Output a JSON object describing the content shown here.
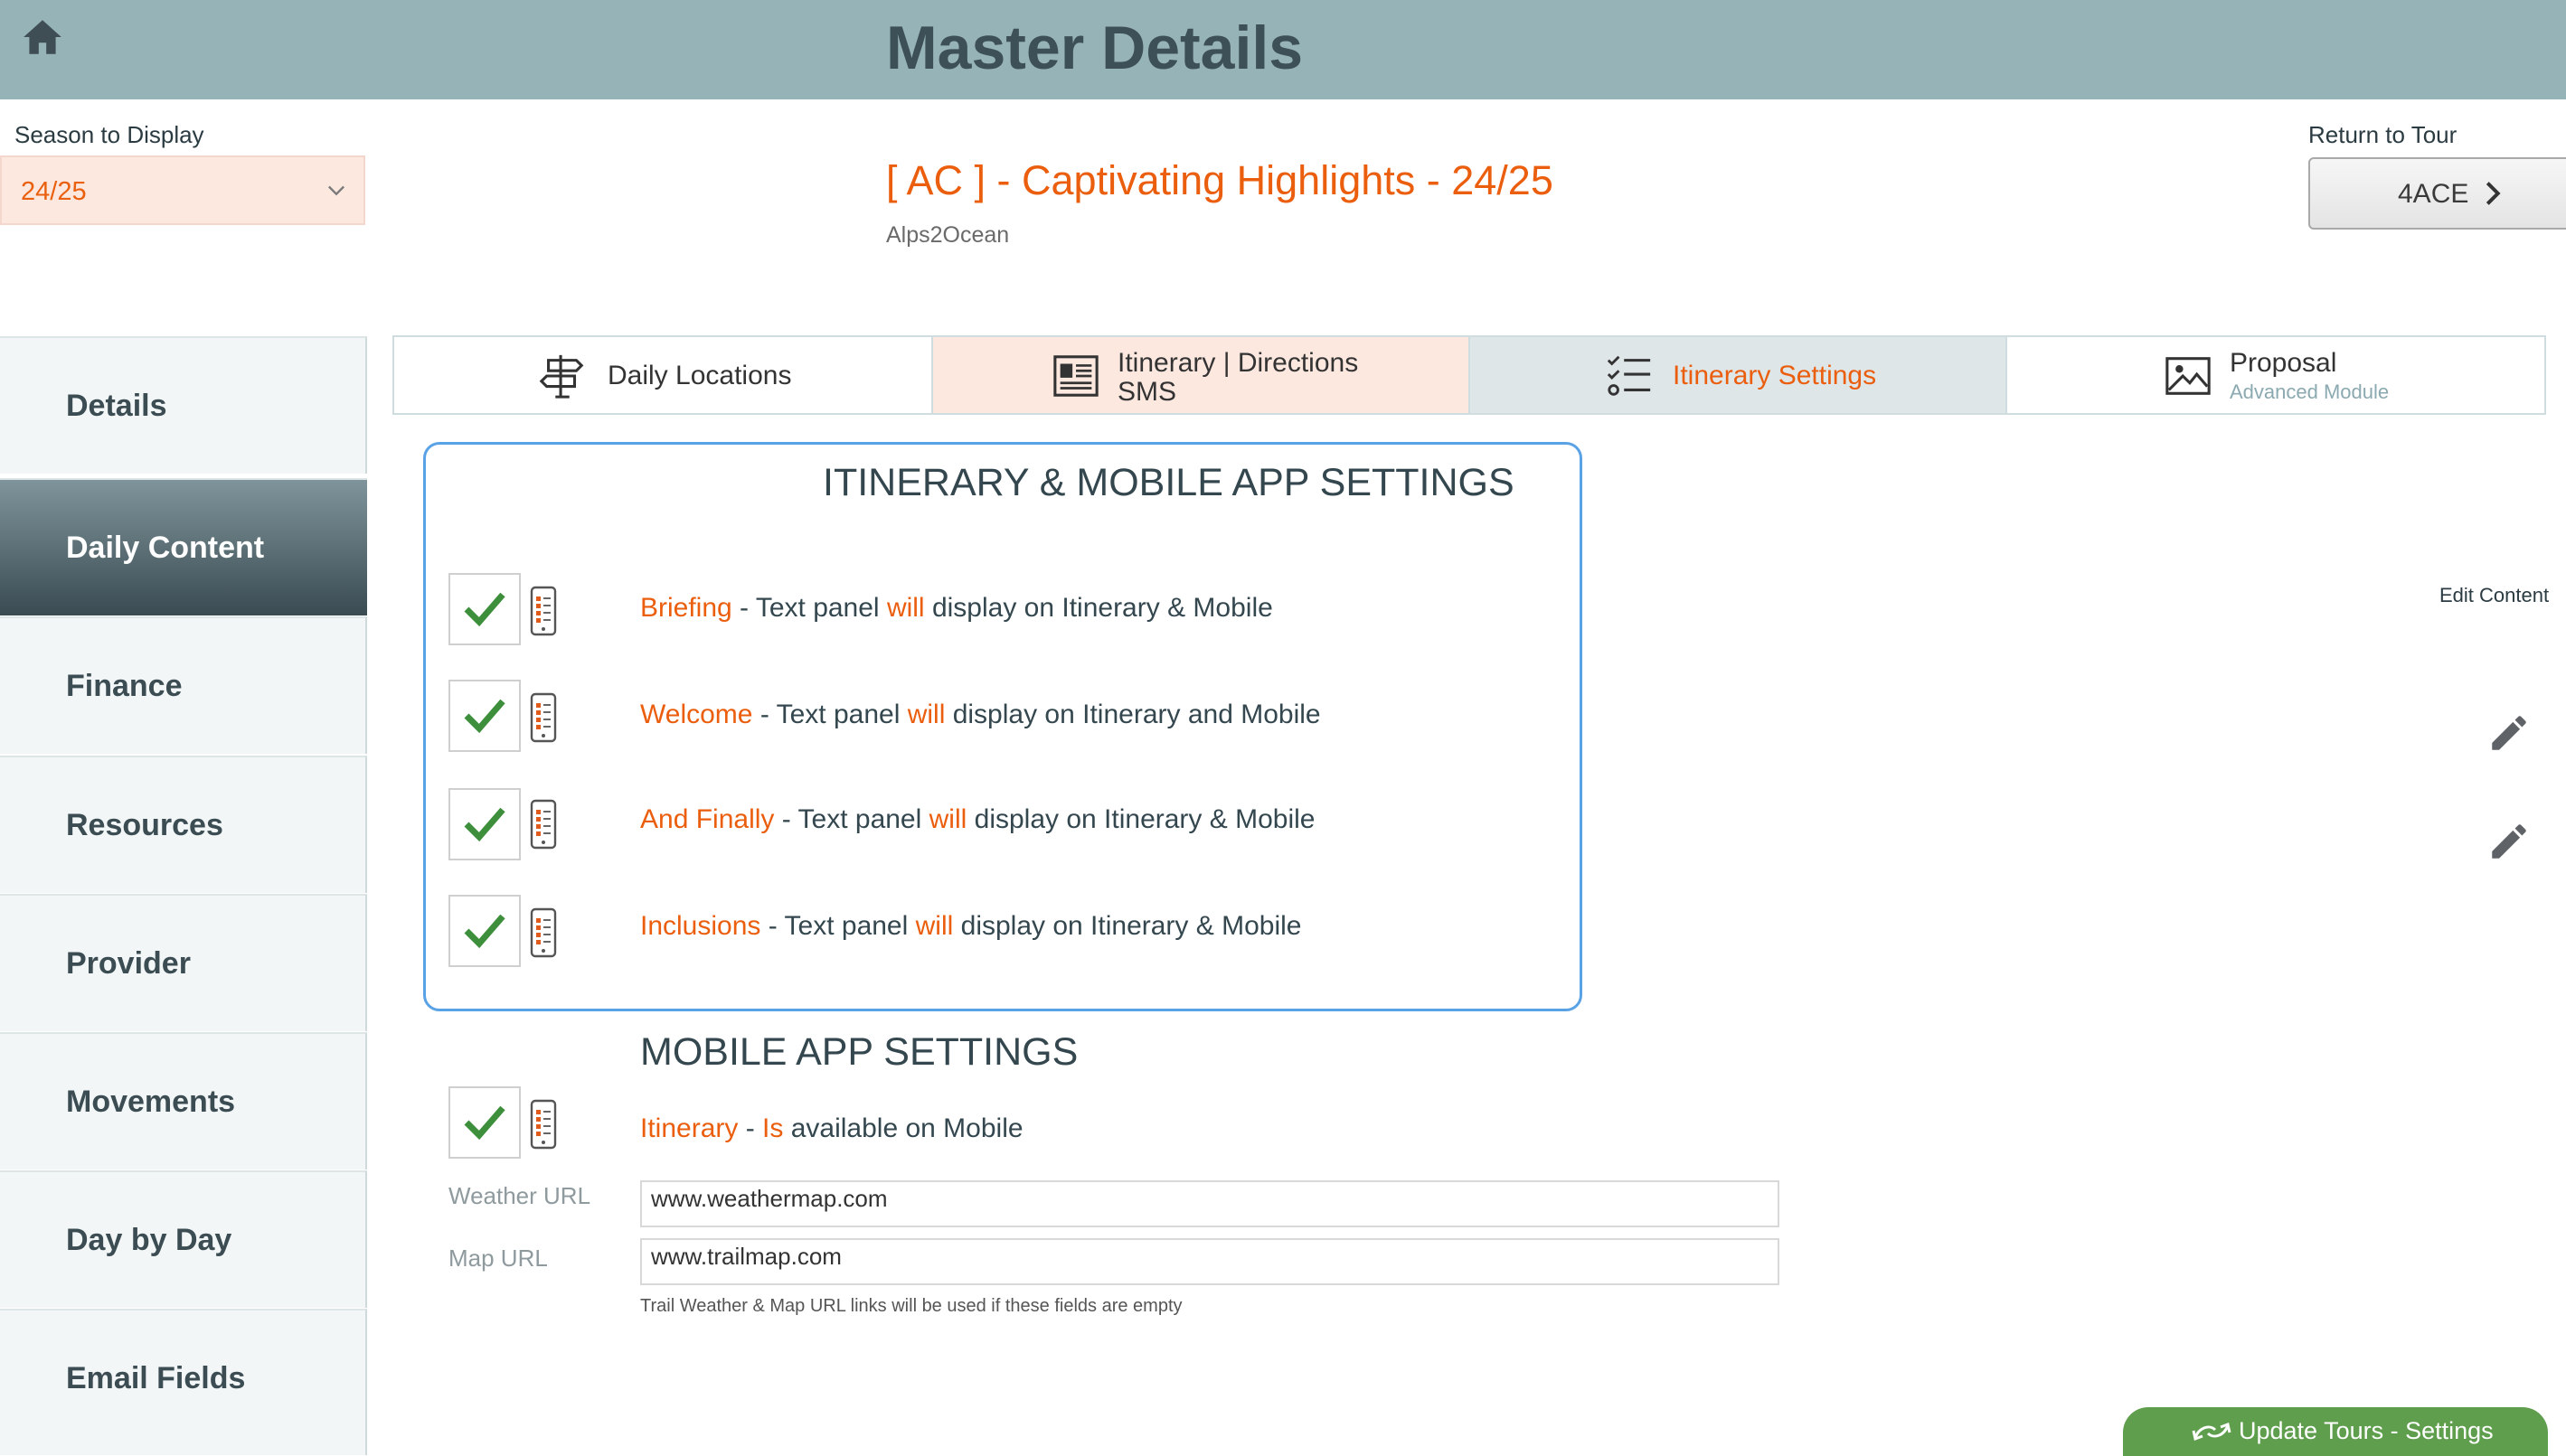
{
  "header": {
    "title": "Master Details"
  },
  "season": {
    "label": "Season to Display",
    "value": "24/25"
  },
  "tour": {
    "title": "[ AC ] - Captivating Highlights - 24/25",
    "subtitle": "Alps2Ocean"
  },
  "return_to_tour": {
    "label": "Return to Tour",
    "button": "4ACE"
  },
  "sidebar": {
    "items": [
      {
        "label": "Details"
      },
      {
        "label": "Daily Content",
        "active": true
      },
      {
        "label": "Finance"
      },
      {
        "label": "Resources"
      },
      {
        "label": "Provider"
      },
      {
        "label": "Movements"
      },
      {
        "label": "Day by Day"
      },
      {
        "label": "Email Fields"
      }
    ]
  },
  "tabs": {
    "daily_locations": "Daily Locations",
    "itinerary_line1": "Itinerary | Directions",
    "itinerary_line2": "SMS",
    "itinerary_settings": "Itinerary Settings",
    "proposal": "Proposal",
    "proposal_sub": "Advanced Module"
  },
  "itinerary_settings": {
    "title": "ITINERARY & MOBILE APP SETTINGS",
    "rows": [
      {
        "name": "Briefing",
        "sep": " - Text panel ",
        "will": "will",
        "rest": " display on Itinerary & Mobile",
        "checked": true
      },
      {
        "name": "Welcome",
        "sep": " - Text panel ",
        "will": "will",
        "rest": " display on Itinerary and Mobile",
        "checked": true
      },
      {
        "name": "And Finally",
        "sep": " - Text panel ",
        "will": "will",
        "rest": " display on Itinerary  & Mobile",
        "checked": true
      },
      {
        "name": "Inclusions",
        "sep": " - Text panel ",
        "will": "will",
        "rest": " display on Itinerary  & Mobile",
        "checked": true
      }
    ]
  },
  "mobile_settings": {
    "title": "MOBILE APP SETTINGS",
    "itinerary_row": {
      "name": "Itinerary",
      "sep": " - ",
      "is": "Is",
      "rest": " available on Mobile",
      "checked": true
    },
    "weather_label": "Weather URL",
    "weather_value": "www.weathermap.com",
    "map_label": "Map URL",
    "map_value": "www.trailmap.com",
    "note": "Trail  Weather & Map URL links will be used if these fields are empty"
  },
  "edit_content": {
    "label": "Edit Content"
  },
  "update_button": {
    "label": "Update Tours - Settings"
  },
  "colors": {
    "accent": "#ea5e0e",
    "header": "#96b3b7",
    "active_tab": "#fde8e0",
    "check": "#3e8f3c",
    "update": "#5f9e4d"
  },
  "icons": [
    "home-icon",
    "chevron-down-icon",
    "chevron-right-icon",
    "signpost-icon",
    "document-icon",
    "checklist-icon",
    "image-icon",
    "checkmark-icon",
    "phone-icon",
    "pencil-icon",
    "refresh-icon"
  ]
}
